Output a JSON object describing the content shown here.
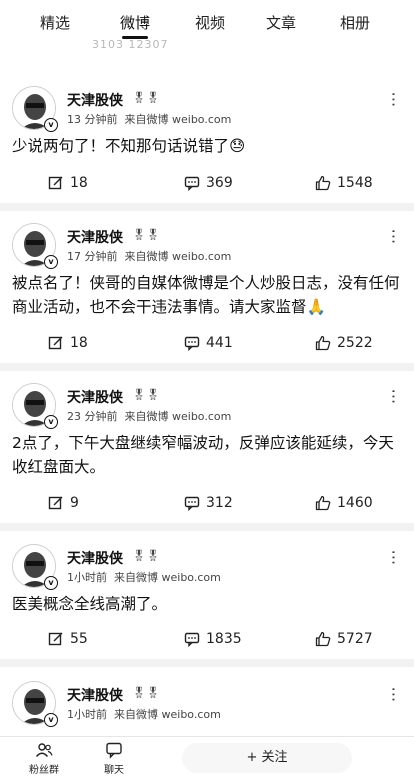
{
  "tabs": [
    {
      "label": "精选"
    },
    {
      "label": "微博"
    },
    {
      "label": "视频"
    },
    {
      "label": "文章"
    },
    {
      "label": "相册"
    }
  ],
  "active_tab": "微博",
  "peek_text": "3103 12307",
  "posts": [
    {
      "author": "天津股侠",
      "badges": "🎖🎖",
      "time": "13 分钟前",
      "source": "来自微博 weibo.com",
      "text": "少说两句了！不知那句话说错了😓",
      "reposts": "18",
      "comments": "369",
      "likes": "1548"
    },
    {
      "author": "天津股侠",
      "badges": "🎖🎖",
      "time": "17 分钟前",
      "source": "来自微博 weibo.com",
      "text": "被点名了！侠哥的自媒体微博是个人炒股日志，没有任何商业活动，也不会干违法事情。请大家监督🙏",
      "reposts": "18",
      "comments": "441",
      "likes": "2522"
    },
    {
      "author": "天津股侠",
      "badges": "🎖🎖",
      "time": "23 分钟前",
      "source": "来自微博 weibo.com",
      "text": "2点了，下午大盘继续窄幅波动，反弹应该能延续，今天收红盘面大。",
      "reposts": "9",
      "comments": "312",
      "likes": "1460"
    },
    {
      "author": "天津股侠",
      "badges": "🎖🎖",
      "time": "1小时前",
      "source": "来自微博 weibo.com",
      "text": "医美概念全线高潮了。",
      "reposts": "55",
      "comments": "1835",
      "likes": "5727"
    },
    {
      "author": "天津股侠",
      "badges": "🎖🎖",
      "time": "1小时前",
      "source": "来自微博 weibo.com"
    }
  ],
  "bottom_bar": {
    "fans_group": "粉丝群",
    "chat": "聊天",
    "follow": "+ 关注"
  },
  "colors": {
    "text": "#111111",
    "meta": "#444444",
    "divider": "#f2f2f2"
  }
}
